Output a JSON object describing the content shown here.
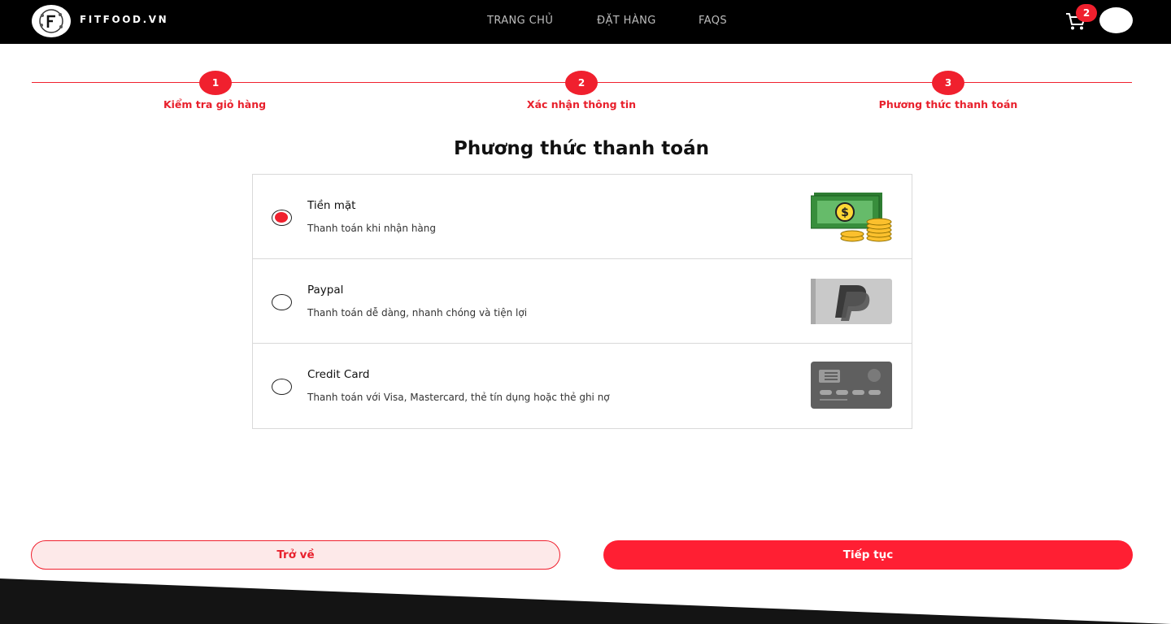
{
  "header": {
    "brand": "FITFOOD.VN",
    "nav": [
      {
        "label": "TRANG CHỦ"
      },
      {
        "label": "ĐẶT HÀNG"
      },
      {
        "label": "FAQS"
      }
    ],
    "cart_count": "2"
  },
  "steps": [
    {
      "number": "1",
      "label": "Kiểm tra giỏ hàng"
    },
    {
      "number": "2",
      "label": "Xác nhận thông tin"
    },
    {
      "number": "3",
      "label": "Phương thức thanh toán"
    }
  ],
  "page_title": "Phương thức thanh toán",
  "payment_methods": [
    {
      "name": "Tiền mặt",
      "description": "Thanh toán khi nhận hàng",
      "selected": true,
      "icon": "cash-money-icon"
    },
    {
      "name": "Paypal",
      "description": "Thanh toán dễ dàng, nhanh chóng và tiện lợi",
      "selected": false,
      "icon": "paypal-icon"
    },
    {
      "name": "Credit Card",
      "description": "Thanh toán với Visa, Mastercard, thẻ tín dụng hoặc thẻ ghi nợ",
      "selected": false,
      "icon": "credit-card-icon"
    }
  ],
  "buttons": {
    "back": "Trở về",
    "next": "Tiếp tục"
  },
  "colors": {
    "accent": "#f0202e",
    "header_bg": "#000000"
  }
}
